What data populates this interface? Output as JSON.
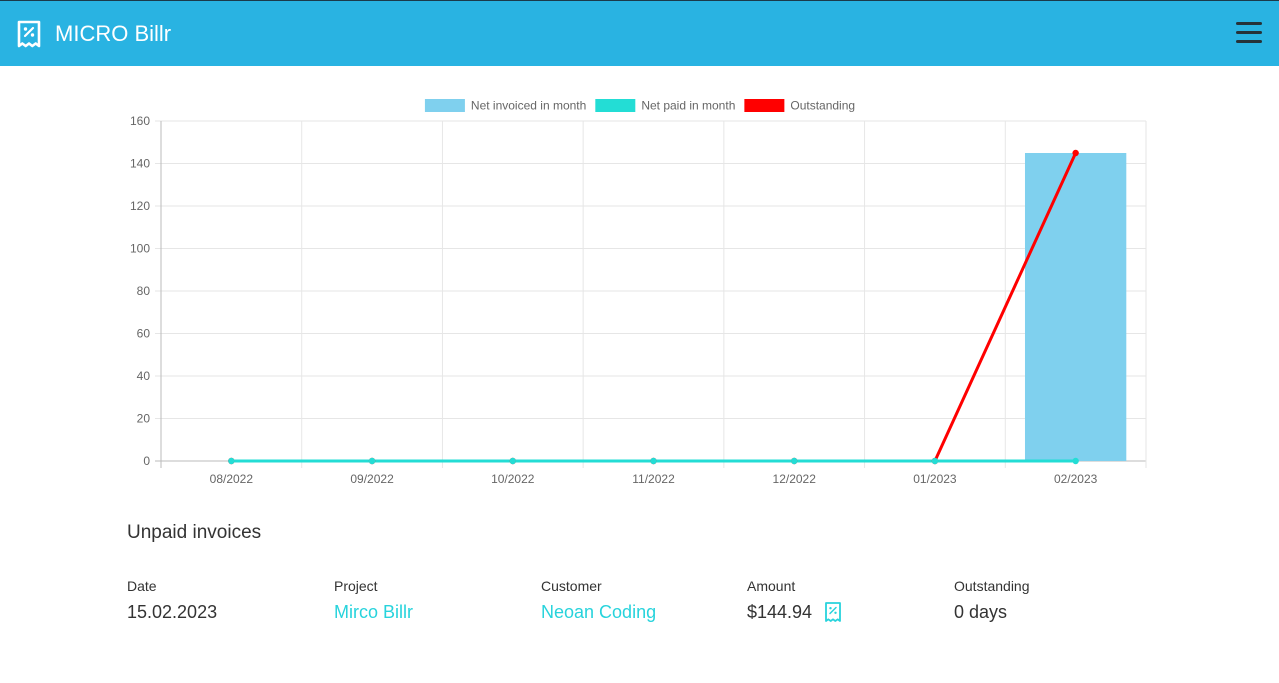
{
  "app": {
    "title": "MICRO Billr",
    "logo_icon": "receipt-percent-icon",
    "menu_icon": "hamburger-icon",
    "brand_color": "#29b3e2"
  },
  "chart_data": {
    "type": "bar",
    "categories": [
      "08/2022",
      "09/2022",
      "10/2022",
      "11/2022",
      "12/2022",
      "01/2023",
      "02/2023"
    ],
    "series": [
      {
        "name": "Net invoiced in month",
        "type": "bar",
        "color": "#7fd0ee",
        "values": [
          0,
          0,
          0,
          0,
          0,
          0,
          144.94
        ]
      },
      {
        "name": "Net paid in month",
        "type": "line",
        "color": "#23ddd5",
        "values": [
          0,
          0,
          0,
          0,
          0,
          0,
          0
        ]
      },
      {
        "name": "Outstanding",
        "type": "line",
        "color": "#ff0000",
        "values": [
          0,
          0,
          0,
          0,
          0,
          0,
          144.94
        ]
      }
    ],
    "yticks": [
      "0",
      "20",
      "40",
      "60",
      "80",
      "100",
      "120",
      "140",
      "160"
    ],
    "ylim": [
      0,
      160
    ],
    "grid": true,
    "legend": "top"
  },
  "unpaid": {
    "title": "Unpaid invoices",
    "headers": {
      "date": "Date",
      "project": "Project",
      "customer": "Customer",
      "amount": "Amount",
      "outstanding": "Outstanding"
    },
    "rows": [
      {
        "date": "15.02.2023",
        "project": "Mirco Billr",
        "customer": "Neoan Coding",
        "amount": "$144.94",
        "outstanding": "0 days",
        "action_icon": "receipt-percent-icon"
      }
    ]
  }
}
